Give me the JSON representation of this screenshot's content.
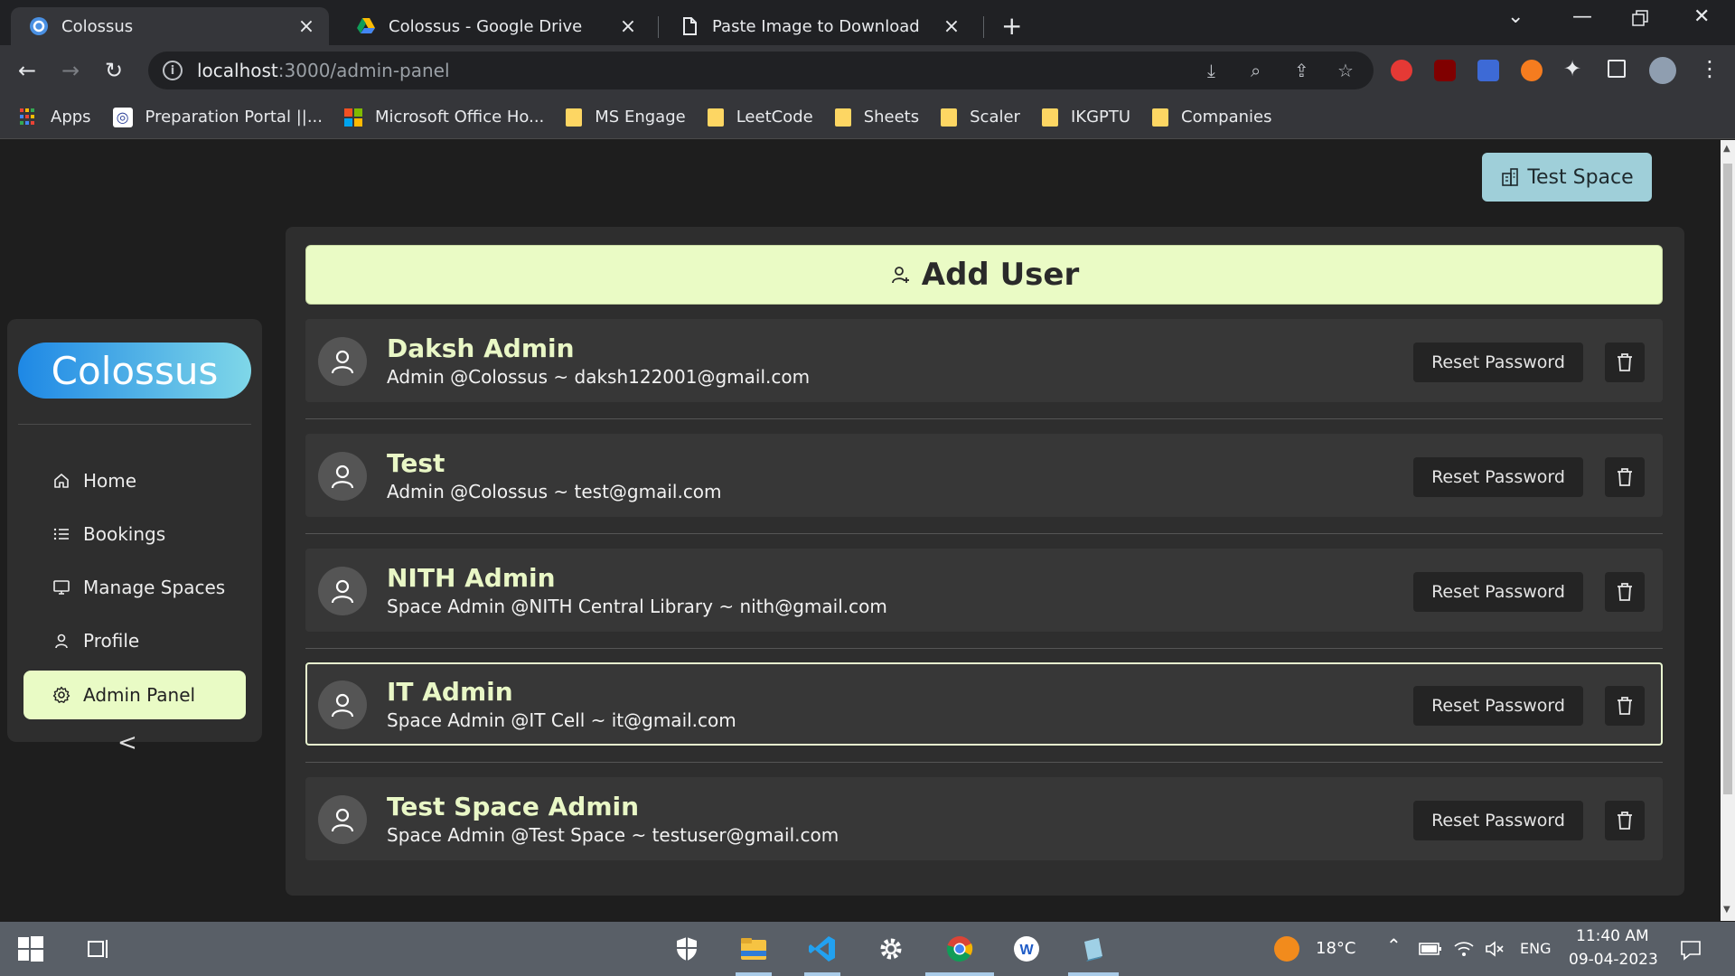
{
  "browser": {
    "tabs": [
      {
        "title": "Colossus",
        "active": true,
        "icon": "colossus-favicon"
      },
      {
        "title": "Colossus - Google Drive",
        "active": false,
        "icon": "google-drive-icon"
      },
      {
        "title": "Paste Image to Download",
        "active": false,
        "icon": "page-icon"
      }
    ],
    "url_host": "localhost",
    "url_path": ":3000/admin-panel",
    "bookmarks": [
      {
        "label": "Apps",
        "icon": "apps-grid-icon"
      },
      {
        "label": "Preparation Portal ||...",
        "icon": "preparation-portal-icon"
      },
      {
        "label": "Microsoft Office Ho...",
        "icon": "microsoft-icon"
      },
      {
        "label": "MS Engage",
        "icon": "folder-icon"
      },
      {
        "label": "LeetCode",
        "icon": "folder-icon"
      },
      {
        "label": "Sheets",
        "icon": "folder-icon"
      },
      {
        "label": "Scaler",
        "icon": "folder-icon"
      },
      {
        "label": "IKGPTU",
        "icon": "folder-icon"
      },
      {
        "label": "Companies",
        "icon": "folder-icon"
      }
    ]
  },
  "header": {
    "space_button": "Test Space"
  },
  "sidebar": {
    "logo": "Colossus",
    "items": [
      {
        "label": "Home",
        "icon": "home-icon",
        "active": false
      },
      {
        "label": "Bookings",
        "icon": "list-icon",
        "active": false
      },
      {
        "label": "Manage Spaces",
        "icon": "monitor-icon",
        "active": false
      },
      {
        "label": "Profile",
        "icon": "user-icon",
        "active": false
      },
      {
        "label": "Admin Panel",
        "icon": "gear-icon",
        "active": true
      }
    ],
    "collapse": "<"
  },
  "main": {
    "add_user_label": "Add User",
    "reset_label": "Reset Password",
    "users": [
      {
        "name": "Daksh Admin",
        "subtitle": "Admin @Colossus ~ daksh122001@gmail.com",
        "selected": false
      },
      {
        "name": "Test",
        "subtitle": "Admin @Colossus ~ test@gmail.com",
        "selected": false
      },
      {
        "name": "NITH Admin",
        "subtitle": "Space Admin @NITH Central Library ~ nith@gmail.com",
        "selected": false
      },
      {
        "name": "IT Admin",
        "subtitle": "Space Admin @IT Cell ~ it@gmail.com",
        "selected": true
      },
      {
        "name": "Test Space Admin",
        "subtitle": "Space Admin @Test Space ~ testuser@gmail.com",
        "selected": false
      }
    ]
  },
  "taskbar": {
    "temperature": "18°C",
    "language": "ENG",
    "time": "11:40 AM",
    "date": "09-04-2023"
  },
  "colors": {
    "accent": "#e9fbc5",
    "panel": "#2e2e2e",
    "card": "#373737",
    "name_text": "#e9f7c6",
    "space_button": "#9fcfd9"
  }
}
